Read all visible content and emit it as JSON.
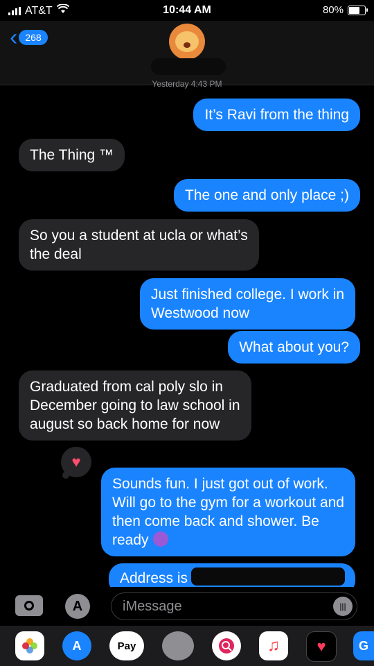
{
  "status_bar": {
    "carrier": "AT&T",
    "time": "10:44 AM",
    "battery": "80%",
    "battery_level": 0.8
  },
  "header": {
    "back_count": "268"
  },
  "thread": {
    "timestamp": "Yesterday 4:43 PM"
  },
  "messages": [
    {
      "from": "me",
      "lines": [
        "It’s Ravi from the thing"
      ]
    },
    {
      "from": "them",
      "lines": [
        "The Thing ™"
      ]
    },
    {
      "from": "me",
      "lines": [
        "The one and only place ;)"
      ]
    },
    {
      "from": "them",
      "lines": [
        "So you a student at ucla or what’s",
        "the deal"
      ]
    },
    {
      "from": "me",
      "lines": [
        "Just finished college. I work in",
        "Westwood now"
      ]
    },
    {
      "from": "me",
      "lines": [
        "What about you?"
      ]
    },
    {
      "from": "them",
      "lines": [
        "Graduated from cal poly slo in",
        "December going to law school in",
        "august so back home for now"
      ]
    },
    {
      "from": "me",
      "lines": [
        "Sounds fun. I just got out of work.",
        "Will go to the gym for a workout and",
        "then come back and shower. Be",
        "ready"
      ],
      "reaction": "heart"
    },
    {
      "from": "me",
      "lines": [
        "Address is"
      ]
    }
  ],
  "composer": {
    "placeholder": "iMessage"
  },
  "app_drawer": {
    "apple_pay_label": "Pay",
    "last_label": "G"
  },
  "colors": {
    "outgoing": "#1a84ff",
    "incoming": "#262629",
    "background": "#000000"
  }
}
